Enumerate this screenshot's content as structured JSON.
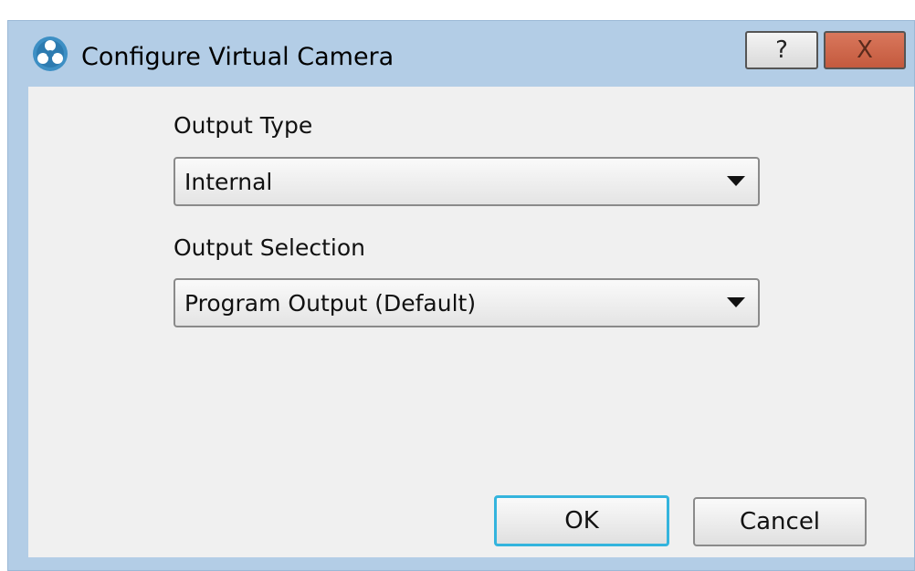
{
  "window": {
    "title": "Configure Virtual Camera",
    "help_label": "?",
    "close_label": "X"
  },
  "form": {
    "output_type_label": "Output Type",
    "output_type_value": "Internal",
    "output_selection_label": "Output Selection",
    "output_selection_value": "Program Output (Default)"
  },
  "buttons": {
    "ok_label": "OK",
    "cancel_label": "Cancel"
  },
  "icons": {
    "app": "obs-logo-icon",
    "dropdown": "chevron-down-icon"
  },
  "colors": {
    "titlebar_bg": "#b3cde6",
    "client_bg": "#f0f0f0",
    "close_bg": "#c45a3e",
    "focus_border": "#34b4dd"
  }
}
